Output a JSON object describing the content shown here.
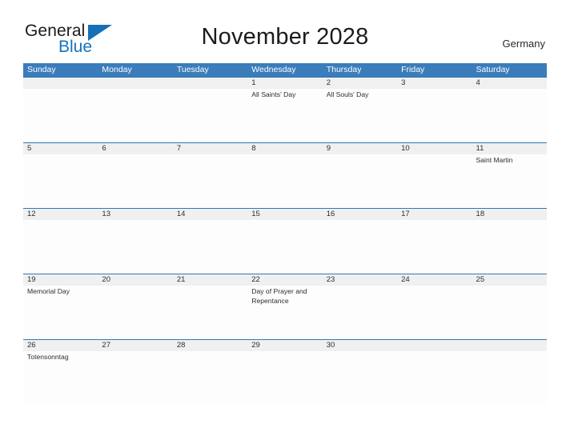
{
  "brand": {
    "name_part1": "General",
    "name_part2": "Blue",
    "triangle_color": "#1570b8"
  },
  "header": {
    "title": "November 2028",
    "region": "Germany",
    "header_bg_color": "#3b7cba",
    "row_line_color": "#2f79b5",
    "date_band_color": "#f0f0f0"
  },
  "weekdays": [
    "Sunday",
    "Monday",
    "Tuesday",
    "Wednesday",
    "Thursday",
    "Friday",
    "Saturday"
  ],
  "weeks": [
    {
      "days": [
        {
          "date": "",
          "event": ""
        },
        {
          "date": "",
          "event": ""
        },
        {
          "date": "",
          "event": ""
        },
        {
          "date": "1",
          "event": "All Saints' Day"
        },
        {
          "date": "2",
          "event": "All Souls' Day"
        },
        {
          "date": "3",
          "event": ""
        },
        {
          "date": "4",
          "event": ""
        }
      ]
    },
    {
      "days": [
        {
          "date": "5",
          "event": ""
        },
        {
          "date": "6",
          "event": ""
        },
        {
          "date": "7",
          "event": ""
        },
        {
          "date": "8",
          "event": ""
        },
        {
          "date": "9",
          "event": ""
        },
        {
          "date": "10",
          "event": ""
        },
        {
          "date": "11",
          "event": "Saint Martin"
        }
      ]
    },
    {
      "days": [
        {
          "date": "12",
          "event": ""
        },
        {
          "date": "13",
          "event": ""
        },
        {
          "date": "14",
          "event": ""
        },
        {
          "date": "15",
          "event": ""
        },
        {
          "date": "16",
          "event": ""
        },
        {
          "date": "17",
          "event": ""
        },
        {
          "date": "18",
          "event": ""
        }
      ]
    },
    {
      "days": [
        {
          "date": "19",
          "event": "Memorial Day"
        },
        {
          "date": "20",
          "event": ""
        },
        {
          "date": "21",
          "event": ""
        },
        {
          "date": "22",
          "event": "Day of Prayer and Repentance"
        },
        {
          "date": "23",
          "event": ""
        },
        {
          "date": "24",
          "event": ""
        },
        {
          "date": "25",
          "event": ""
        }
      ]
    },
    {
      "days": [
        {
          "date": "26",
          "event": "Totensonntag"
        },
        {
          "date": "27",
          "event": ""
        },
        {
          "date": "28",
          "event": ""
        },
        {
          "date": "29",
          "event": ""
        },
        {
          "date": "30",
          "event": ""
        },
        {
          "date": "",
          "event": ""
        },
        {
          "date": "",
          "event": ""
        }
      ]
    }
  ]
}
